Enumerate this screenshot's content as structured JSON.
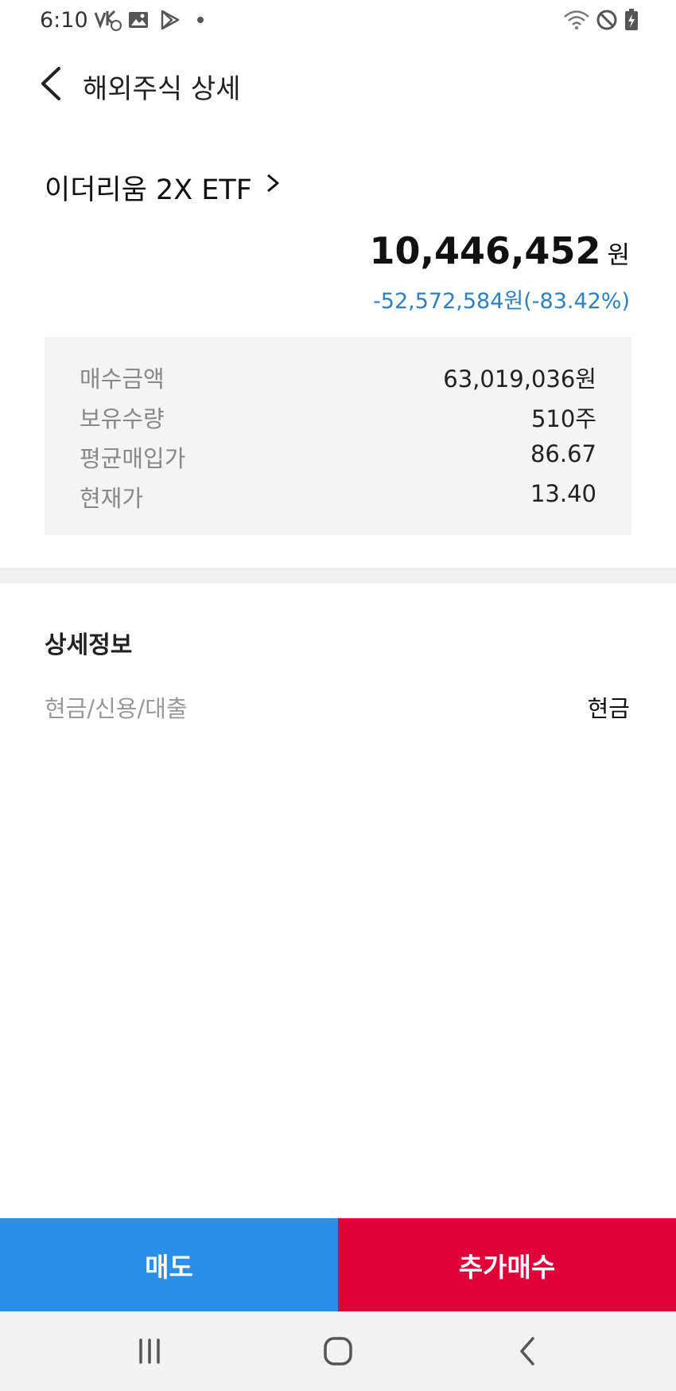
{
  "status_bar": {
    "time": "6:10",
    "icons": [
      "volte-icon",
      "image-icon",
      "play-store-icon",
      "wifi-icon",
      "do-not-disturb-icon",
      "battery-charging-icon"
    ]
  },
  "header": {
    "title": "해외주식 상세"
  },
  "stock": {
    "name": "이더리움 2X ETF",
    "total_value": "10,446,452",
    "total_unit": "원",
    "pnl": "-52,572,584원(-83.42%)",
    "pnl_color": "#2e80c0"
  },
  "summary": {
    "rows": [
      {
        "label": "매수금액",
        "value": "63,019,036원"
      },
      {
        "label": "보유수량",
        "value": "510주"
      },
      {
        "label": "평균매입가",
        "value": "86.67"
      },
      {
        "label": "현재가",
        "value": "13.40"
      }
    ]
  },
  "details": {
    "title": "상세정보",
    "rows": [
      {
        "label": "현금/신용/대출",
        "value": "현금"
      }
    ]
  },
  "actions": {
    "sell_label": "매도",
    "buy_label": "추가매수",
    "sell_color": "#2b8ee8",
    "buy_color": "#e0003a"
  },
  "nav_bar": {
    "icons": [
      "recent-apps-icon",
      "home-icon",
      "back-icon"
    ]
  }
}
